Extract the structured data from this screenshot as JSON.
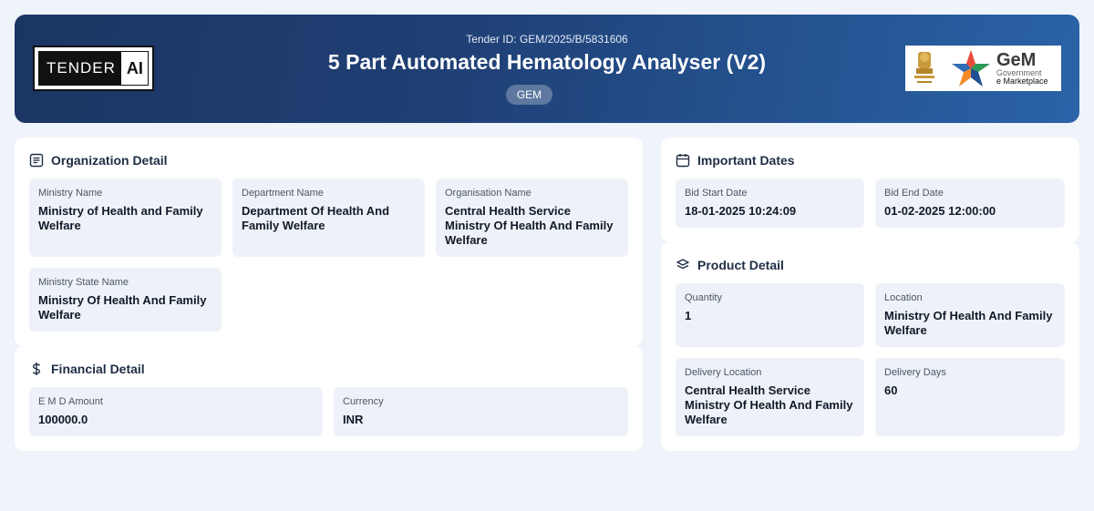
{
  "header": {
    "logo_left": {
      "part1": "TENDER",
      "part2": "AI"
    },
    "tender_id": "Tender ID: GEM/2025/B/5831606",
    "title": "5 Part Automated Hematology Analyser (V2)",
    "badge": "GEM",
    "logo_right": {
      "big": "GeM",
      "small": "Government",
      "small2": "e Marketplace"
    }
  },
  "organization": {
    "title": "Organization Detail",
    "icon": "list-icon",
    "fields": [
      {
        "label": "Ministry Name",
        "value": "Ministry of Health and Family Welfare"
      },
      {
        "label": "Department Name",
        "value": "Department Of Health And Family Welfare"
      },
      {
        "label": "Organisation Name",
        "value": "Central Health Service Ministry Of Health And Family Welfare"
      },
      {
        "label": "Ministry State Name",
        "value": "Ministry Of Health And Family Welfare"
      }
    ]
  },
  "financial": {
    "title": "Financial Detail",
    "icon": "dollar-icon",
    "fields": [
      {
        "label": "E M D Amount",
        "value": "100000.0"
      },
      {
        "label": "Currency",
        "value": "INR"
      }
    ]
  },
  "dates": {
    "title": "Important Dates",
    "icon": "calendar-icon",
    "fields": [
      {
        "label": "Bid Start Date",
        "value": "18-01-2025 10:24:09"
      },
      {
        "label": "Bid End Date",
        "value": "01-02-2025 12:00:00"
      }
    ]
  },
  "product": {
    "title": "Product Detail",
    "icon": "layers-icon",
    "fields": [
      {
        "label": "Quantity",
        "value": "1"
      },
      {
        "label": "Location",
        "value": "Ministry Of Health And Family Welfare"
      },
      {
        "label": "Delivery Location",
        "value": "Central Health Service Ministry Of Health And Family Welfare"
      },
      {
        "label": "Delivery Days",
        "value": "60"
      }
    ]
  }
}
